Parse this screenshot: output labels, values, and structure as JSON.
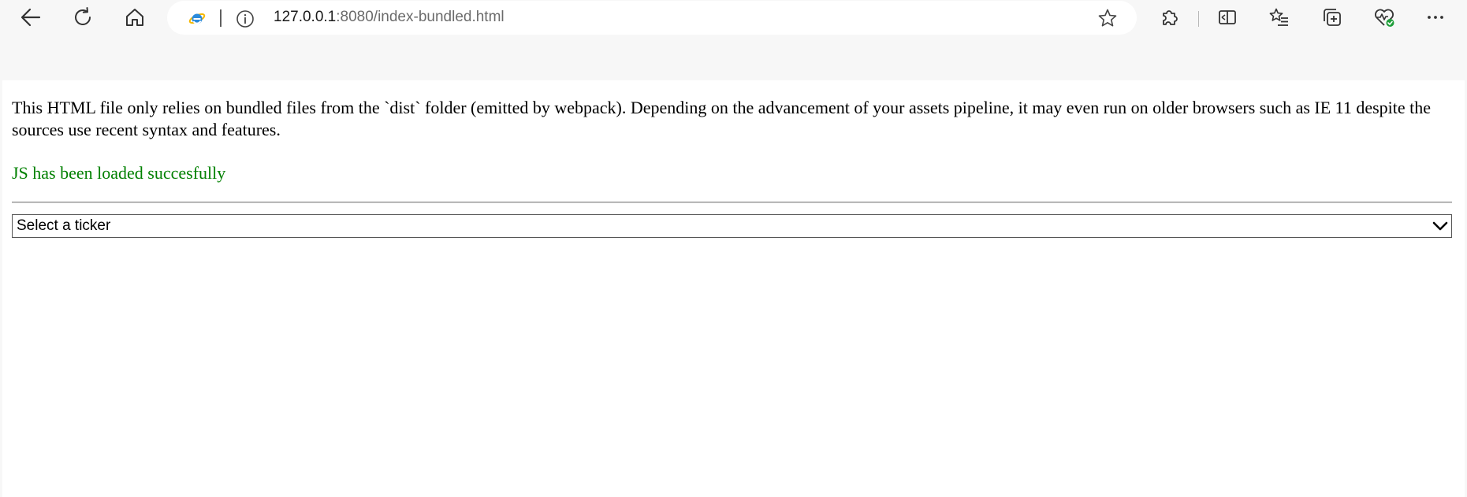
{
  "browser": {
    "url_host": "127.0.0.1",
    "url_rest": ":8080/index-bundled.html",
    "icons": {
      "back": "back-arrow-icon",
      "reload": "reload-icon",
      "home": "home-icon",
      "site": "internet-explorer-icon",
      "info": "info-icon",
      "favorite": "star-icon",
      "extensions": "puzzle-extension-icon",
      "split_screen": "split-screen-icon",
      "favorites": "favorites-list-icon",
      "collections": "collections-icon",
      "health": "browser-essentials-icon",
      "more": "more-dots-icon"
    }
  },
  "page": {
    "intro_text": "This HTML file only relies on bundled files from the `dist` folder (emitted by webpack). Depending on the advancement of your assets pipeline, it may even run on older browsers such as IE 11 despite the sources use recent syntax and features.",
    "status_text": "JS has been loaded succesfully",
    "status_color": "#008000",
    "ticker_select": {
      "selected_label": "Select a ticker"
    }
  }
}
